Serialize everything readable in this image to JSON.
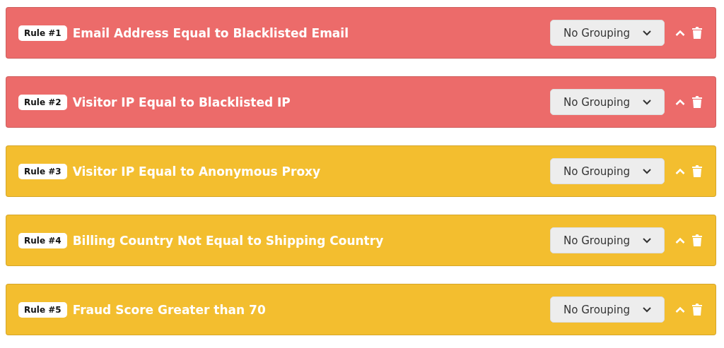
{
  "rules": [
    {
      "badge": "Rule #1",
      "title": "Email Address Equal to Blacklisted Email",
      "color": "#ec6b6a",
      "grouping": "No Grouping"
    },
    {
      "badge": "Rule #2",
      "title": "Visitor IP Equal to Blacklisted IP",
      "color": "#ec6b6a",
      "grouping": "No Grouping"
    },
    {
      "badge": "Rule #3",
      "title": "Visitor IP Equal to Anonymous Proxy",
      "color": "#f3be2f",
      "grouping": "No Grouping"
    },
    {
      "badge": "Rule #4",
      "title": "Billing Country Not Equal to Shipping Country",
      "color": "#f3be2f",
      "grouping": "No Grouping"
    },
    {
      "badge": "Rule #5",
      "title": "Fraud Score Greater than 70",
      "color": "#f3be2f",
      "grouping": "No Grouping"
    }
  ]
}
